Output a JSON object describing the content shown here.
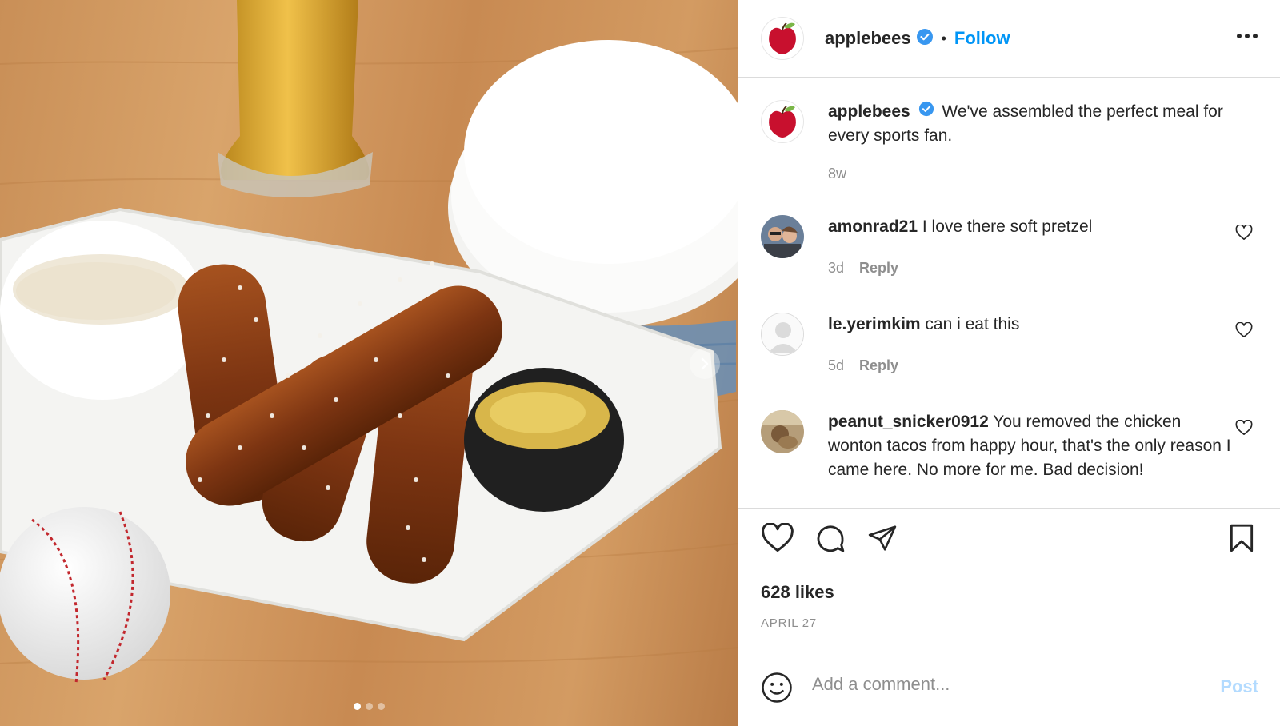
{
  "post": {
    "image_alt": "Soft pretzel sticks with dipping sauces, beer, plates and a baseball",
    "carousel": {
      "slide_count": 3,
      "active_index": 0
    }
  },
  "header": {
    "username": "applebees",
    "verified": true,
    "separator": "•",
    "follow_label": "Follow",
    "more_icon": "more-horizontal-icon"
  },
  "caption": {
    "username": "applebees",
    "text": "We've assembled the perfect meal for every sports fan.",
    "age": "8w"
  },
  "comments": [
    {
      "username": "amonrad21",
      "text": "I love there soft pretzel",
      "age": "3d",
      "reply_label": "Reply"
    },
    {
      "username": "le.yerimkim",
      "text": "can i eat this",
      "age": "5d",
      "reply_label": "Reply"
    },
    {
      "username": "peanut_snicker0912",
      "text": "You removed the chicken wonton tacos from happy hour, that's the only reason I came here. No more for me. Bad decision!",
      "age": "",
      "reply_label": ""
    }
  ],
  "actions": {
    "like_icon": "heart-icon",
    "comment_icon": "comment-icon",
    "share_icon": "send-icon",
    "save_icon": "bookmark-icon"
  },
  "likes": "628 likes",
  "date": "APRIL 27",
  "add_comment": {
    "placeholder": "Add a comment...",
    "post_label": "Post"
  },
  "colors": {
    "link_blue": "#0095f6",
    "post_disabled": "#b3dbff",
    "muted": "#8e8e8e",
    "brand_red": "#c8102e"
  }
}
